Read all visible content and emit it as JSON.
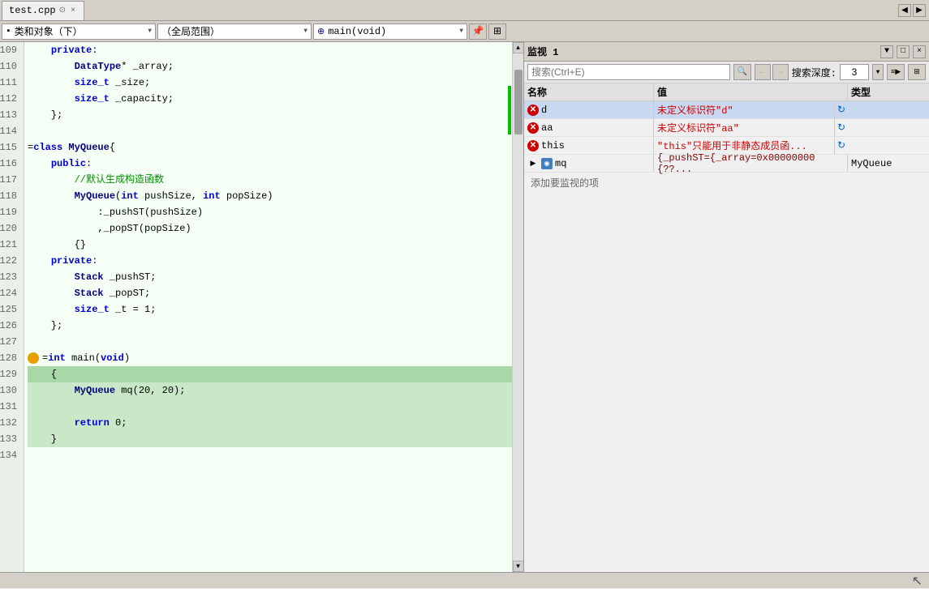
{
  "tab": {
    "filename": "test.cpp",
    "close_label": "×",
    "nav_left": "◀",
    "nav_right": "▶"
  },
  "toolbar": {
    "class_dropdown": "类和对象（下）",
    "scope_dropdown": "（全局范围）",
    "func_dropdown": "main(void)",
    "pin_label": "📌",
    "expand_label": "⊞"
  },
  "code": {
    "lines": [
      {
        "num": "109",
        "text": "    private:",
        "highlighted": false
      },
      {
        "num": "110",
        "text": "        DataType* _array;",
        "highlighted": false
      },
      {
        "num": "111",
        "text": "        size_t _size;",
        "highlighted": false
      },
      {
        "num": "112",
        "text": "        size_t _capacity;",
        "highlighted": false
      },
      {
        "num": "113",
        "text": "    };",
        "highlighted": false
      },
      {
        "num": "114",
        "text": "",
        "highlighted": false
      },
      {
        "num": "115",
        "text": "=class MyQueue{",
        "highlighted": false
      },
      {
        "num": "116",
        "text": "    public:",
        "highlighted": false
      },
      {
        "num": "117",
        "text": "        //默认生成构造函数",
        "highlighted": false
      },
      {
        "num": "118",
        "text": "        MyQueue(int pushSize, int popSize)",
        "highlighted": false
      },
      {
        "num": "119",
        "text": "            :_pushST(pushSize)",
        "highlighted": false
      },
      {
        "num": "120",
        "text": "            ,_popST(popSize)",
        "highlighted": false
      },
      {
        "num": "121",
        "text": "        {}",
        "highlighted": false
      },
      {
        "num": "122",
        "text": "    private:",
        "highlighted": false
      },
      {
        "num": "123",
        "text": "        Stack _pushST;",
        "highlighted": false
      },
      {
        "num": "124",
        "text": "        Stack _popST;",
        "highlighted": false
      },
      {
        "num": "125",
        "text": "        size_t _t = 1;",
        "highlighted": false
      },
      {
        "num": "126",
        "text": "    };",
        "highlighted": false
      },
      {
        "num": "127",
        "text": "",
        "highlighted": false
      },
      {
        "num": "128",
        "text": "=int main(void)",
        "highlighted": false
      },
      {
        "num": "129",
        "text": "    {",
        "highlighted": true,
        "is_current": true
      },
      {
        "num": "130",
        "text": "        MyQueue mq(20, 20);",
        "highlighted": true
      },
      {
        "num": "131",
        "text": "",
        "highlighted": true
      },
      {
        "num": "132",
        "text": "        return 0;",
        "highlighted": true
      },
      {
        "num": "133",
        "text": "    }",
        "highlighted": true
      },
      {
        "num": "134",
        "text": "",
        "highlighted": false
      }
    ]
  },
  "watch": {
    "title": "监视 1",
    "minimize_btn": "▼",
    "restore_btn": "□",
    "close_btn": "×",
    "search_placeholder": "搜索(Ctrl+E)",
    "nav_back": "←",
    "nav_forward": "→",
    "depth_label": "搜索深度:",
    "depth_value": "3",
    "col_name": "名称",
    "col_value": "值",
    "col_type": "类型",
    "rows": [
      {
        "type": "error",
        "name": "d",
        "value": "未定义标识符\"d\"",
        "type_val": "",
        "selected": true
      },
      {
        "type": "error",
        "name": "aa",
        "value": "未定义标识符\"aa\"",
        "type_val": "",
        "selected": false
      },
      {
        "type": "error",
        "name": "this",
        "value": "\"this\"只能用于非静态成员函...",
        "type_val": "",
        "selected": false
      },
      {
        "type": "object",
        "name": "mq",
        "value": "{_pushST={_array=0x00000000 {??...",
        "type_val": "MyQueue",
        "selected": false,
        "expandable": true
      }
    ],
    "add_watch_label": "添加要监视的项"
  },
  "statusbar": {
    "cursor_icon": "↖"
  }
}
